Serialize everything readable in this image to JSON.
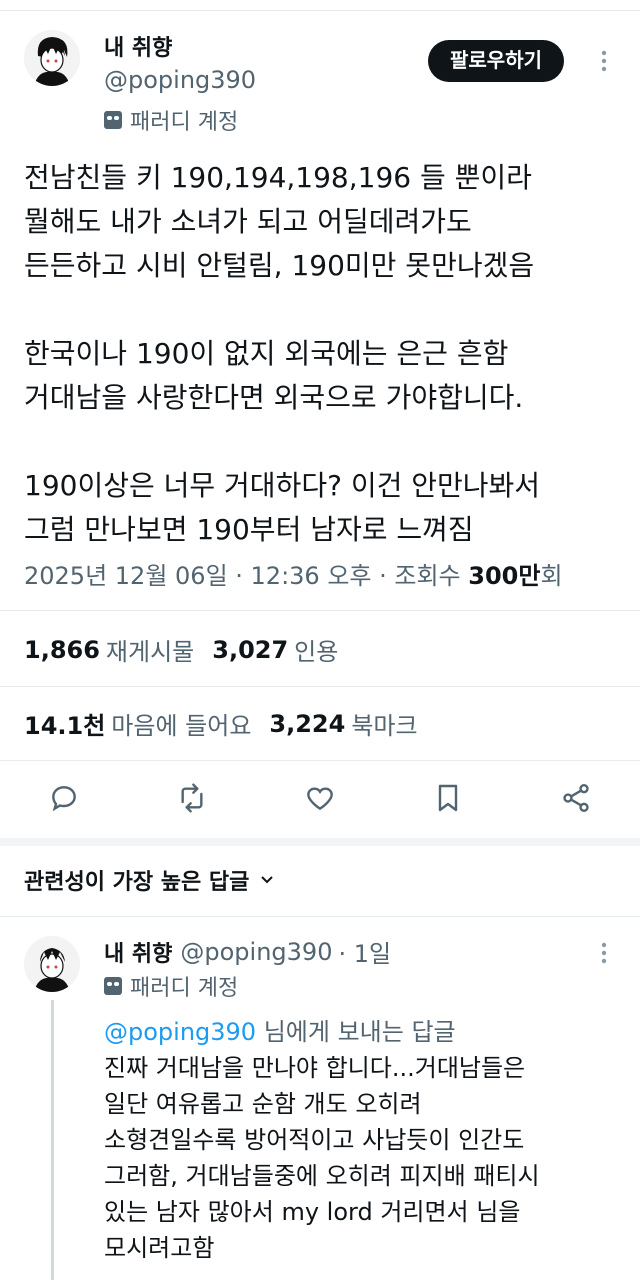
{
  "tweet": {
    "author": {
      "name": "내 취향",
      "handle": "@poping390",
      "badge": "패러디 계정"
    },
    "follow_label": "팔로우하기",
    "more_icon": "more-icon",
    "text": "전남친들 키 190,194,198,196 들 뿐이라\n뭘해도 내가 소녀가 되고 어딜데려가도\n든든하고 시비 안털림, 190미만 못만나겠음\n\n한국이나 190이 없지 외국에는 은근 흔함\n거대남을 사랑한다면 외국으로 가야합니다.\n\n190이상은 너무 거대하다? 이건 안만나봐서\n그럼 만나보면 190부터 남자로 느껴짐",
    "timestamp": "2025년 12월 06일 · 12:36 오후 · 조회수 ",
    "views": "300만",
    "views_suffix": "회"
  },
  "stats": {
    "retweets": {
      "value": "1,866",
      "label": "재게시물"
    },
    "quotes": {
      "value": "3,027",
      "label": "인용"
    },
    "likes": {
      "value": "14.1천",
      "label": "마음에 들어요"
    },
    "bookmarks": {
      "value": "3,224",
      "label": "북마크"
    }
  },
  "actions": [
    "reply-icon",
    "retweet-icon",
    "like-icon",
    "bookmark-icon",
    "share-icon"
  ],
  "replies_header": {
    "label": "관련성이 가장 높은 답글",
    "chevron": "chevron-down-icon"
  },
  "reply": {
    "author": {
      "name": "내 취향",
      "handle": "@poping390",
      "time": "· 1일",
      "badge": "패러디 계정"
    },
    "replying_to": {
      "mention": "@poping390",
      "suffix": " 님에게 보내는 답글"
    },
    "text": "진짜 거대남을 만나야 합니다...거대남들은\n일단 여유롭고 순함 개도 오히려\n소형견일수록 방어적이고  사납듯이 인간도\n그러함, 거대남들중에 오히려 피지배 패티시\n있는 남자 많아서 my lord 거리면서 님을\n모시려고함"
  },
  "colors": {
    "text": "#0f1419",
    "secondary": "#536471",
    "accent": "#1d9bf0",
    "divider": "#e6ecf0",
    "button": "#0f1419"
  }
}
